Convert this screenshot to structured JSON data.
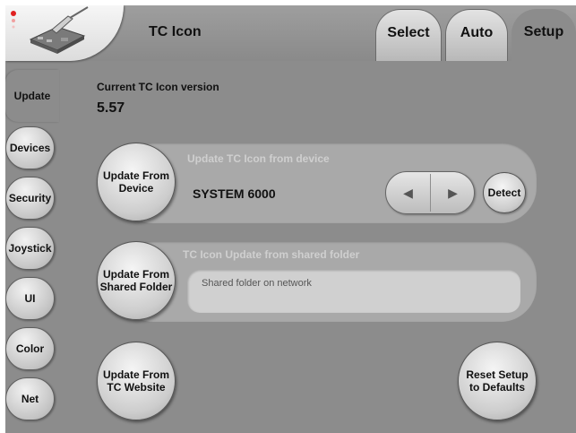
{
  "header": {
    "title": "TC Icon",
    "tabs": [
      {
        "label": "Select"
      },
      {
        "label": "Auto"
      },
      {
        "label": "Setup"
      }
    ]
  },
  "left_nav": {
    "items": [
      {
        "label": "Update"
      },
      {
        "label": "Devices"
      },
      {
        "label": "Security"
      },
      {
        "label": "Joystick"
      },
      {
        "label": "UI"
      },
      {
        "label": "Color"
      },
      {
        "label": "Net"
      }
    ]
  },
  "main": {
    "version_label": "Current TC Icon version",
    "version_value": "5.57",
    "device_panel": {
      "heading": "Update TC Icon from device",
      "button_label": "Update From\nDevice",
      "device_name": "SYSTEM 6000",
      "prev_icon": "◀",
      "next_icon": "▶",
      "detect_label": "Detect"
    },
    "folder_panel": {
      "heading": "TC Icon Update from shared folder",
      "button_label": "Update From\nShared Folder",
      "input_text": "Shared folder on network"
    },
    "website_button_label": "Update From\nTC Website",
    "reset_button_label": "Reset Setup\nto Defaults"
  },
  "icons": {
    "logo": "tc-icon-console-logo",
    "prev": "left-arrow-icon",
    "next": "right-arrow-icon"
  }
}
